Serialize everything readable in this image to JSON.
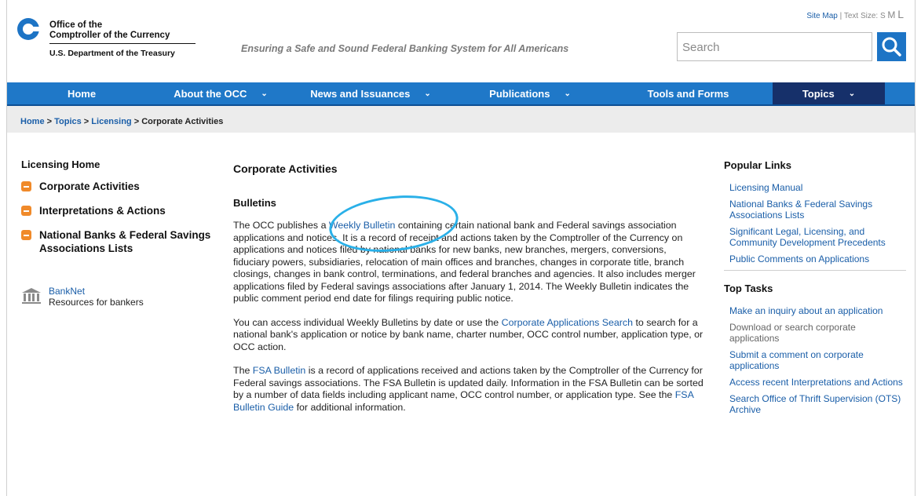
{
  "header": {
    "logo_line1": "Office of the",
    "logo_line2": "Comptroller of the Currency",
    "logo_line3": "U.S. Department of the Treasury",
    "tagline": "Ensuring a Safe and Sound Federal Banking System for All Americans",
    "site_map": "Site Map",
    "text_size_label": "| Text Size:",
    "size_s": "S",
    "size_m": "M",
    "size_l": "L",
    "search_placeholder": "Search"
  },
  "nav": {
    "items": [
      {
        "label": "Home",
        "chevron": ""
      },
      {
        "label": "About the OCC",
        "chevron": "⌄"
      },
      {
        "label": "News and Issuances",
        "chevron": "⌄"
      },
      {
        "label": "Publications",
        "chevron": "⌄"
      },
      {
        "label": "Tools and Forms",
        "chevron": ""
      },
      {
        "label": "Topics",
        "chevron": "⌄"
      }
    ]
  },
  "breadcrumb": {
    "home": "Home",
    "topics": "Topics",
    "licensing": "Licensing",
    "sep": " > ",
    "current": "Corporate Activities"
  },
  "left": {
    "heading": "Licensing Home",
    "items": [
      "Corporate Activities",
      "Interpretations & Actions",
      "National Banks & Federal Savings Associations Lists"
    ],
    "banknet_link": "BankNet",
    "banknet_desc": "Resources for bankers"
  },
  "main": {
    "title": "Corporate Activities",
    "subtitle": "Bulletins",
    "p1_a": "The OCC publishes a ",
    "p1_link": "Weekly Bulletin",
    "p1_b": " containing certain national bank and Federal savings association applications and notices. It is a record of receipt and actions taken by the Comptroller of the Currency on applications and notices filed by national banks for new banks, new branches, mergers, conversions, fiduciary powers, subsidiaries, relocation of main offices and branches, changes in corporate title, branch closings, changes in bank control, terminations, and federal branches and agencies. It also includes merger applications filed by Federal savings associations after January 1, 2014.  The Weekly Bulletin indicates the public comment period end date for filings requiring public notice.",
    "p2_a": "You can access individual Weekly Bulletins by date or use the ",
    "p2_link": "Corporate Applications Search",
    "p2_b": " to search for a national bank's application or notice by bank name, charter number, OCC control number, application type, or OCC action.",
    "p3_a": "The ",
    "p3_link1": "FSA Bulletin",
    "p3_b": " is a record of applications received and actions taken by the Comptroller of the Currency for Federal savings associations. The FSA Bulletin is updated daily. Information in the FSA Bulletin can be sorted by a number of data fields including applicant name, OCC control number, or application type. See the ",
    "p3_link2": "FSA Bulletin Guide",
    "p3_c": " for additional information."
  },
  "right": {
    "popular_heading": "Popular Links",
    "popular": [
      "Licensing Manual",
      "National Banks & Federal Savings Associations Lists",
      "Significant Legal, Licensing, and Community Development Precedents",
      "Public Comments on Applications"
    ],
    "tasks_heading": "Top Tasks",
    "task1": "Make an inquiry about an application",
    "task2": "Download or search corporate applications",
    "task3": "Submit a comment on corporate applications",
    "task4": "Access recent Interpretations and Actions",
    "task5": "Search Office of Thrift Supervision (OTS) Archive"
  },
  "colors": {
    "nav_blue": "#1f78c8",
    "nav_active": "#16306a",
    "link": "#1a5ea8",
    "bullet_orange": "#f08a2a",
    "annotation_circle": "#2ab0e8"
  }
}
